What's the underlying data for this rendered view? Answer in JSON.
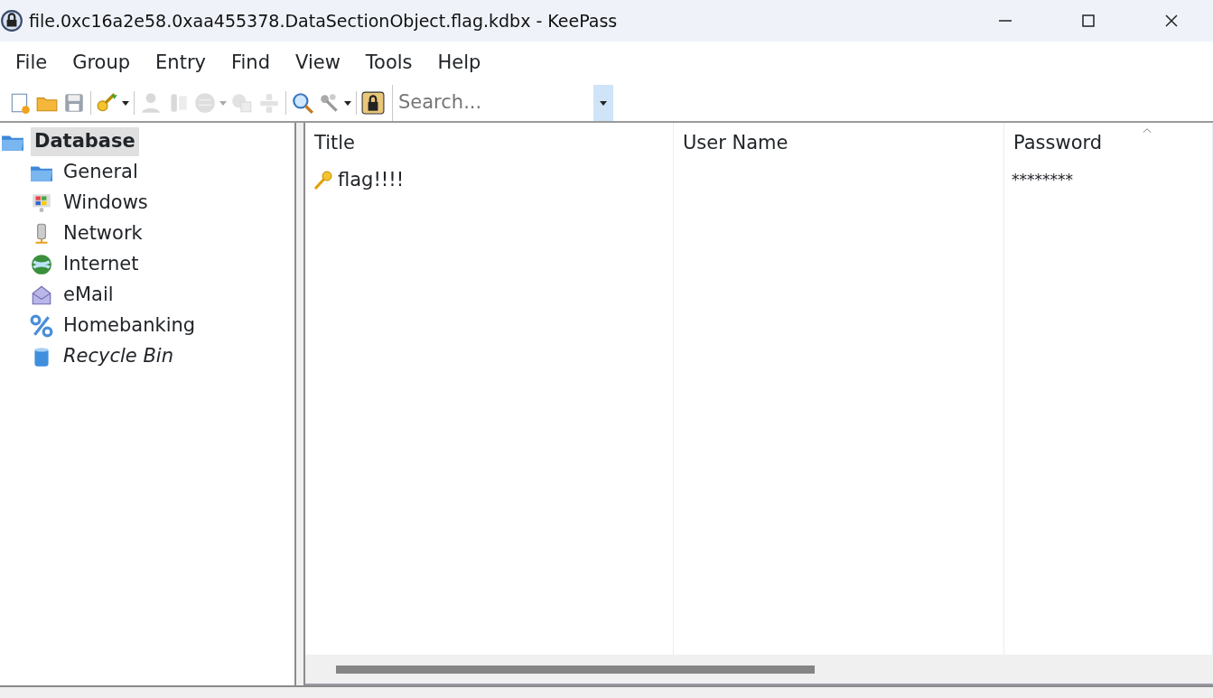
{
  "window": {
    "title": "file.0xc16a2e58.0xaa455378.DataSectionObject.flag.kdbx - KeePass"
  },
  "menu": [
    {
      "label": "File"
    },
    {
      "label": "Group"
    },
    {
      "label": "Entry"
    },
    {
      "label": "Find"
    },
    {
      "label": "View"
    },
    {
      "label": "Tools"
    },
    {
      "label": "Help"
    }
  ],
  "toolbar": {
    "groups": [
      [
        {
          "kind": "new",
          "disabled": false
        },
        {
          "kind": "open",
          "disabled": false
        },
        {
          "kind": "save",
          "disabled": false
        }
      ],
      [
        {
          "kind": "add-entry",
          "disabled": false,
          "dropdown": true
        }
      ],
      [
        {
          "kind": "user",
          "disabled": true
        },
        {
          "kind": "key",
          "disabled": true
        },
        {
          "kind": "globe",
          "disabled": true,
          "dropdown": true
        },
        {
          "kind": "copy",
          "disabled": true
        },
        {
          "kind": "move",
          "disabled": true
        }
      ],
      [
        {
          "kind": "find",
          "disabled": false
        },
        {
          "kind": "keys",
          "disabled": false,
          "dropdown": true
        }
      ],
      [
        {
          "kind": "lock",
          "disabled": false
        }
      ]
    ],
    "search": {
      "placeholder": "Search..."
    }
  },
  "tree": [
    {
      "label": "Database",
      "kind": "folder",
      "selected": true,
      "children": [
        {
          "label": "General",
          "kind": "folder",
          "selected": false
        },
        {
          "label": "Windows",
          "kind": "windows",
          "selected": false
        },
        {
          "label": "Network",
          "kind": "network",
          "selected": false
        },
        {
          "label": "Internet",
          "kind": "internet",
          "selected": false
        },
        {
          "label": "eMail",
          "kind": "email",
          "selected": false
        },
        {
          "label": "Homebanking",
          "kind": "homebanking",
          "selected": false
        },
        {
          "label": "Recycle Bin",
          "kind": "recycle",
          "selected": false
        }
      ]
    }
  ],
  "table": {
    "columns": [
      "Title",
      "User Name",
      "Password"
    ],
    "rows": [
      {
        "cells": [
          "flag!!!!",
          "",
          "********"
        ]
      }
    ]
  }
}
